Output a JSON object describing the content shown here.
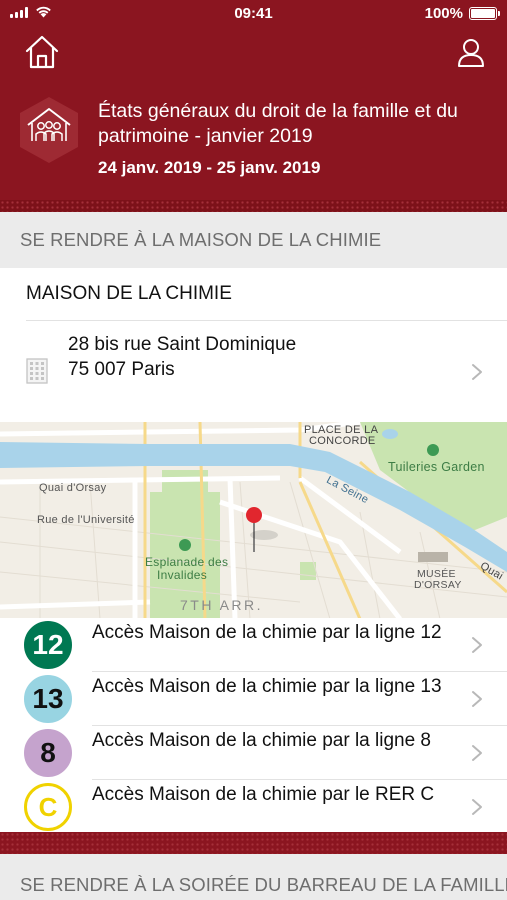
{
  "status_bar": {
    "time": "09:41",
    "battery": "100%"
  },
  "event": {
    "title": "États généraux du droit de la famille et du patrimoine - janvier 2019",
    "dates": "24 janv. 2019 - 25 janv. 2019"
  },
  "sections": {
    "first": "SE RENDRE À LA MAISON DE LA CHIMIE",
    "second": "SE RENDRE À LA SOIRÉE DU BARREAU DE LA FAMILLE"
  },
  "venue": {
    "name": "MAISON DE LA CHIMIE",
    "address_line1": "28 bis rue Saint Dominique",
    "address_line2": "75 007 Paris"
  },
  "map": {
    "labels": {
      "concorde_1": "PLACE DE LA",
      "concorde_2": "CONCORDE",
      "tuileries": "Tuileries Garden",
      "seine": "La Seine",
      "quai_orsay": "Quai d'Orsay",
      "rue_universite": "Rue de l'Université",
      "esplanade_1": "Esplanade des",
      "esplanade_2": "Invalides",
      "musee_1": "MUSÉE",
      "musee_2": "D'ORSAY",
      "arr": "7TH ARR.",
      "quai_edge": "Quai"
    }
  },
  "transit": [
    {
      "badge": "12",
      "label": "Accès Maison de la chimie par la ligne 12",
      "bg": "#007852",
      "fg": "#ffffff",
      "border": "#007852"
    },
    {
      "badge": "13",
      "label": "Accès Maison de la chimie par la ligne 13",
      "bg": "#98d4e2",
      "fg": "#111111",
      "border": "#98d4e2"
    },
    {
      "badge": "8",
      "label": "Accès Maison de la chimie par la ligne 8",
      "bg": "#c5a3cd",
      "fg": "#111111",
      "border": "#c5a3cd"
    },
    {
      "badge": "C",
      "label": "Accès Maison de la chimie par le RER C",
      "bg": "#ffffff",
      "fg": "#f0d200",
      "border": "#f0d200"
    }
  ],
  "colors": {
    "brand": "#8b1520",
    "section_bg": "#ebebeb",
    "section_text": "#6e6e6e",
    "river": "#a9d3ea",
    "park": "#c9e4b0"
  },
  "icons": [
    "home-icon",
    "profile-icon",
    "family-group-icon",
    "building-icon",
    "chevron-right-icon",
    "map-pin-icon"
  ]
}
